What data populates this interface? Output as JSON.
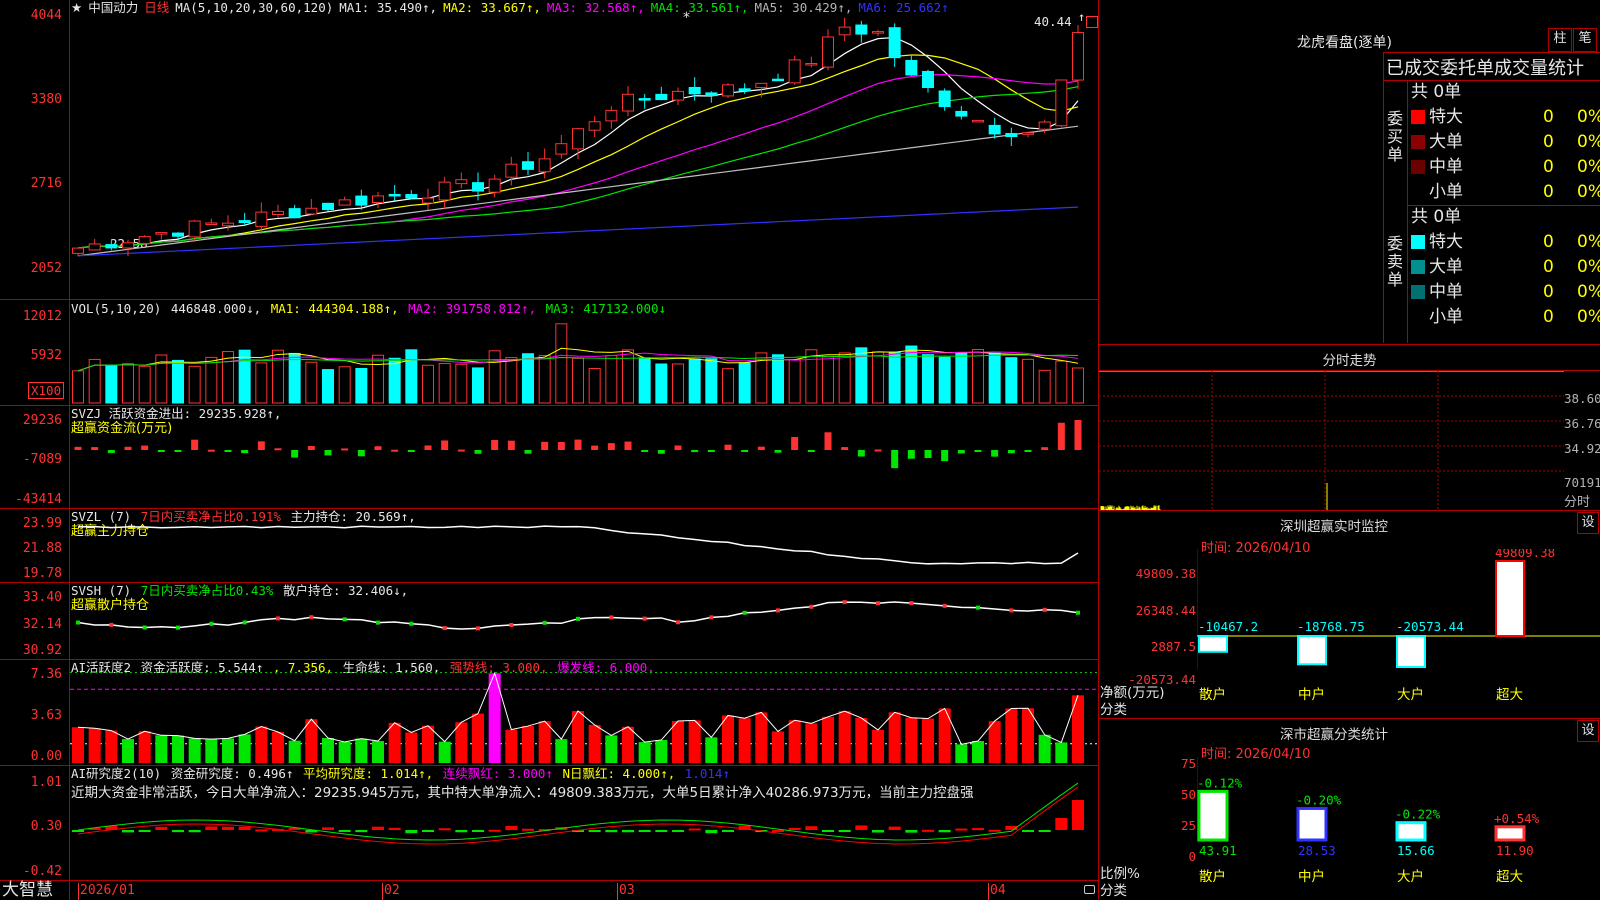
{
  "colors": {
    "up": "#ff3232",
    "down": "#00ffff",
    "bg": "#000000",
    "grid": "#b00000",
    "ma1": "#ffffff",
    "ma2": "#ffff00",
    "ma3": "#ff00ff",
    "ma4": "#00e600",
    "ma5": "#c0c0c0",
    "ma6": "#3232ff"
  },
  "main": {
    "star": "★",
    "stock_name": "中国动力",
    "period": "日线",
    "ma_def": "MA(5,10,20,30,60,120)",
    "ma1": "MA1: 35.490↑,",
    "ma2": "MA2: 33.667↑,",
    "ma3": "MA3: 32.568↑,",
    "ma4": "MA4: 33.561↑,",
    "ma5": "MA5: 30.429↑,",
    "ma6": "MA6: 25.662↑",
    "y_labels": [
      "4044",
      "3380",
      "2716",
      "2052"
    ],
    "high_label": "40.44",
    "low_label": "22.58",
    "high_marker": "*",
    "up_arrow_icon": "↑"
  },
  "vol": {
    "def": "VOL(5,10,20)",
    "value": "446848.000↓,",
    "ma1": "MA1: 444304.188↑,",
    "ma2": "MA2: 391758.812↑,",
    "ma3": "MA3: 417132.000↓",
    "y_labels": [
      "12012",
      "5932"
    ],
    "unit": "X100"
  },
  "svzj": {
    "line1": "SVZJ  活跃资金进出: 29235.928↑,",
    "line2": "超赢资金流(万元)",
    "y_labels": [
      "29236",
      "-7089",
      "-43414"
    ]
  },
  "svzl": {
    "def": "SVZL (7)",
    "p1": "7日内买卖净占比0.191%",
    "p2": "主力持仓: 20.569↑,",
    "line2": "超赢主力持仓",
    "y_labels": [
      "23.99",
      "21.88",
      "19.78"
    ]
  },
  "svsh": {
    "def": "SVSH (7)",
    "p1": "7日内买卖净占比0.43%",
    "p2": "散户持仓: 32.406↓,",
    "line2": "超赢散户持仓",
    "y_labels": [
      "33.40",
      "32.14",
      "30.92"
    ]
  },
  "ai1": {
    "def": "AI活跃度2",
    "p1": "资金活跃度: 5.544↑",
    "p2": ", 7.356,",
    "p3": "生命线: 1.560,",
    "p4": "强势线: 3.000,",
    "p5": "爆发线: 6.000,",
    "y_labels": [
      "7.36",
      "3.63",
      "0.00"
    ]
  },
  "ai2": {
    "def": "AI研究度2(10)",
    "p1": "资金研究度: 0.496↑",
    "p2": "平均研究度: 1.014↑,",
    "p3": "连续飘红: 3.000↑",
    "p4": "N日飘红: 4.000↑,",
    "p5": "1.014↑",
    "commentary": "近期大资金非常活跃，今日大单净流入：29235.945万元，其中特大单净流入：49809.383万元，大单5日累计净入40286.973万元，当前主力控盘强",
    "y_labels": [
      "1.01",
      "0.30",
      "-0.42"
    ]
  },
  "footer": {
    "brand": "大智慧",
    "dates": [
      "2026/01",
      "02",
      "03",
      "04"
    ],
    "lock_icon": "lock-icon"
  },
  "lhb": {
    "title": "龙虎看盘(逐单)",
    "btn1": "柱",
    "btn2": "笔",
    "header": "已成交委托单成交量统计",
    "buy_label": "委买单",
    "sell_label": "委卖单",
    "buy_total": "共 0单",
    "sell_total": "共 0单",
    "buy_rows": [
      {
        "name": "特大",
        "count": "0",
        "pct": "0%",
        "color": "#ff0000"
      },
      {
        "name": "大单",
        "count": "0",
        "pct": "0%",
        "color": "#8b0000"
      },
      {
        "name": "中单",
        "count": "0",
        "pct": "0%",
        "color": "#6a0000"
      },
      {
        "name": "小单",
        "count": "0",
        "pct": "0%",
        "color": "#000000"
      }
    ],
    "sell_rows": [
      {
        "name": "特大",
        "count": "0",
        "pct": "0%",
        "color": "#00ffff"
      },
      {
        "name": "大单",
        "count": "0",
        "pct": "0%",
        "color": "#009090"
      },
      {
        "name": "中单",
        "count": "0",
        "pct": "0%",
        "color": "#007070"
      },
      {
        "name": "小单",
        "count": "0",
        "pct": "0%",
        "color": "#000000"
      }
    ]
  },
  "fenshi": {
    "title": "分时走势",
    "y_labels": [
      "38.60",
      "36.76",
      "34.92"
    ],
    "vol_label": "70191",
    "sub_label": "分时"
  },
  "sz_monitor": {
    "title": "深圳超赢实时监控",
    "settings": "设",
    "time": "时间: 2026/04/10",
    "y_labels": [
      "49809.38",
      "26348.44",
      "2887.5",
      "-20573.44"
    ],
    "left_label1": "净额(万元)",
    "left_label2": "分类",
    "bars": [
      {
        "cat": "散户",
        "value": -10467.2,
        "label": "-10467.2"
      },
      {
        "cat": "中户",
        "value": -18768.75,
        "label": "-18768.75"
      },
      {
        "cat": "大户",
        "value": -20573.44,
        "label": "-20573.44"
      },
      {
        "cat": "超大",
        "value": 49809.38,
        "label": "49809.38"
      }
    ]
  },
  "sz_stats": {
    "title": "深市超赢分类统计",
    "settings": "设",
    "time": "时间: 2026/04/10",
    "y_labels": [
      "75",
      "50",
      "25",
      "0"
    ],
    "left_label1": "比例%",
    "left_label2": "分类",
    "bars": [
      {
        "cat": "散户",
        "value": 43.91,
        "label": "43.91",
        "chg": "-0.12%"
      },
      {
        "cat": "中户",
        "value": 28.53,
        "label": "28.53",
        "chg": "-0.20%"
      },
      {
        "cat": "大户",
        "value": 15.66,
        "label": "15.66",
        "chg": "-0.22%"
      },
      {
        "cat": "超大",
        "value": 11.9,
        "label": "11.90",
        "chg": "+0.54%"
      }
    ]
  }
}
